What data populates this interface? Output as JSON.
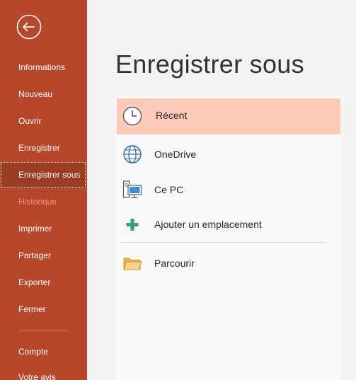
{
  "sidebar": {
    "back_icon": "arrow-left-circle-icon",
    "accent_color": "#b7472a",
    "items": [
      {
        "label": "Informations"
      },
      {
        "label": "Nouveau"
      },
      {
        "label": "Ouvrir"
      },
      {
        "label": "Enregistrer"
      },
      {
        "label": "Enregistrer sous",
        "selected": true
      },
      {
        "label": "Historique",
        "disabled": true
      },
      {
        "label": "Imprimer"
      },
      {
        "label": "Partager"
      },
      {
        "label": "Exporter"
      },
      {
        "label": "Fermer"
      },
      {
        "label": "Compte"
      },
      {
        "label": "Votre avis"
      }
    ]
  },
  "main": {
    "title": "Enregistrer sous",
    "locations": [
      {
        "label": "Récent",
        "icon": "clock-icon",
        "selected": true
      },
      {
        "label": "OneDrive",
        "icon": "globe-icon"
      },
      {
        "label": "Ce PC",
        "icon": "computer-icon"
      },
      {
        "label": "Ajouter un emplacement",
        "icon": "plus-icon"
      },
      {
        "label": "Parcourir",
        "icon": "folder-icon"
      }
    ]
  }
}
